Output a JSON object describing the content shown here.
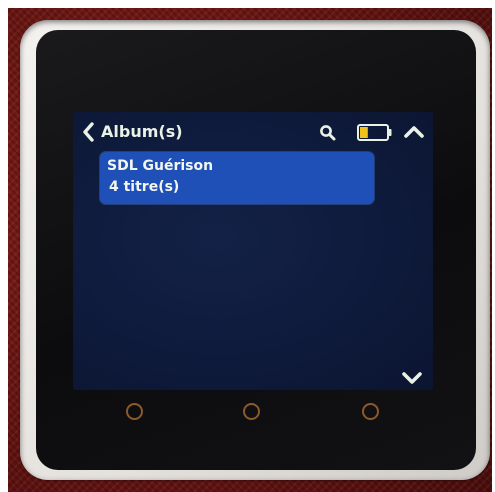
{
  "header": {
    "title": "Album(s)",
    "icons": {
      "back": "chevron-left-icon",
      "search": "search-icon",
      "battery": "battery-icon",
      "up": "chevron-up-icon"
    },
    "battery_level": 0.3
  },
  "albums": [
    {
      "name": "SDL Guérison",
      "track_count": "4 titre(s)",
      "selected": true
    }
  ],
  "footer": {
    "icons": {
      "down": "chevron-down-icon"
    }
  },
  "colors": {
    "screen_bg": "#0e1a3a",
    "selection": "#1f50b8",
    "text": "#f3f6ee",
    "battery_fill": "#f2c21b",
    "icon": "#eaf1e6"
  }
}
